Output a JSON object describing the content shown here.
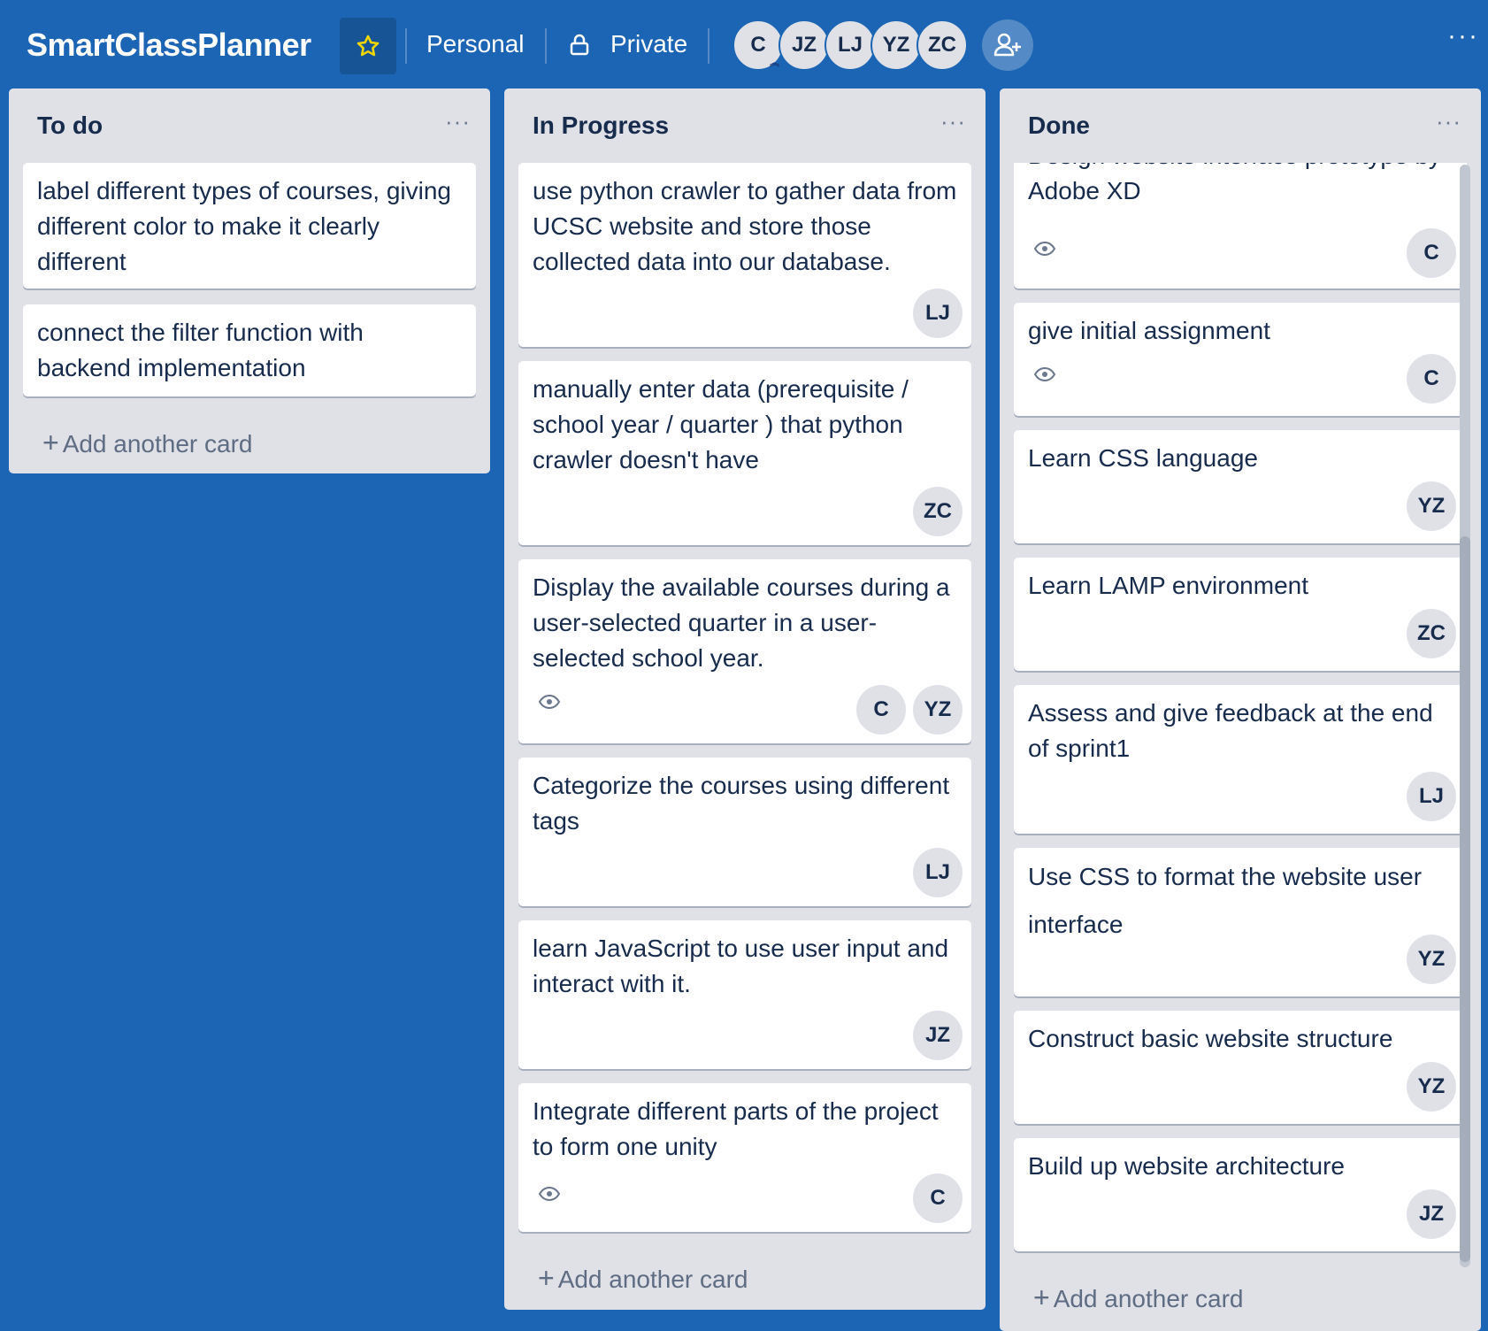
{
  "board": {
    "title": "SmartClassPlanner",
    "visibility_team": "Personal",
    "visibility_privacy": "Private",
    "members": [
      "C",
      "JZ",
      "LJ",
      "YZ",
      "ZC"
    ],
    "more": "···"
  },
  "colors": {
    "background": "#1b65b4",
    "list": "#dfe1e6",
    "star": "#f2d600"
  },
  "lists": [
    {
      "title": "To do",
      "more": "···",
      "add_label": "Add another card",
      "cards": [
        {
          "text": "label different types of courses, giving different color to make it clearly different",
          "members": []
        },
        {
          "text": "connect the filter function with backend implementation",
          "members": []
        }
      ]
    },
    {
      "title": "In Progress",
      "more": "···",
      "add_label": "Add another card",
      "cards": [
        {
          "text": "use python crawler to gather data from UCSC website and store those collected data into our database.",
          "members": [
            "LJ"
          ]
        },
        {
          "text": "manually enter data (prerequisite / school year / quarter ) that python crawler doesn't have",
          "members": [
            "ZC"
          ]
        },
        {
          "text": "Display the available courses during a user-selected quarter in a user-selected school year.",
          "members": [
            "C",
            "YZ"
          ],
          "watched": true
        },
        {
          "text": "Categorize the courses using different tags",
          "members": [
            "LJ"
          ]
        },
        {
          "text": "learn JavaScript to use user input and interact with it.",
          "members": [
            "JZ"
          ]
        },
        {
          "text": "Integrate different parts of the project to form one unity",
          "members": [
            "C"
          ],
          "watched": true
        }
      ]
    },
    {
      "title": "Done",
      "more": "···",
      "add_label": "Add another card",
      "cards": [
        {
          "text": "Design website interface prototype by Adobe XD",
          "members": [
            "C"
          ],
          "watched": true
        },
        {
          "text": "give initial assignment",
          "members": [
            "C"
          ],
          "watched": true
        },
        {
          "text": "Learn CSS language",
          "members": [
            "YZ"
          ]
        },
        {
          "text": "Learn LAMP environment",
          "members": [
            "ZC"
          ]
        },
        {
          "text": "Assess and give feedback at the end of sprint1",
          "members": [
            "LJ"
          ]
        },
        {
          "text": "Use CSS to format the website user interface",
          "members": [
            "YZ"
          ]
        },
        {
          "text": "Construct basic website structure",
          "members": [
            "YZ"
          ]
        },
        {
          "text": "Build up website architecture",
          "members": [
            "JZ"
          ]
        }
      ]
    }
  ]
}
